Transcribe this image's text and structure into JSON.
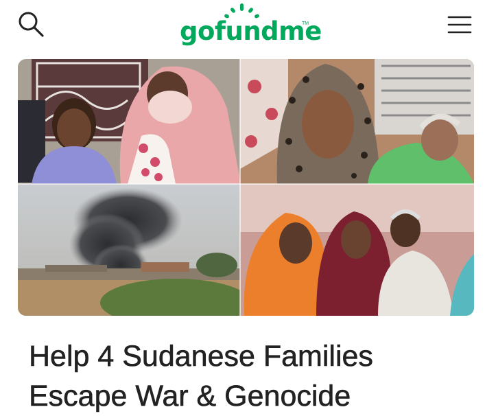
{
  "header": {
    "logo_text": "gofundme",
    "logo_tm": "TM",
    "brand_color": "#02a95c",
    "search_icon": "search-icon",
    "menu_icon": "hamburger-menu-icon"
  },
  "campaign": {
    "title_line1": "Help 4 Sudanese Families",
    "title_line2": "Escape War & Genocide",
    "hero_image": "collage of four photos: family members and smoke rising over a town"
  }
}
